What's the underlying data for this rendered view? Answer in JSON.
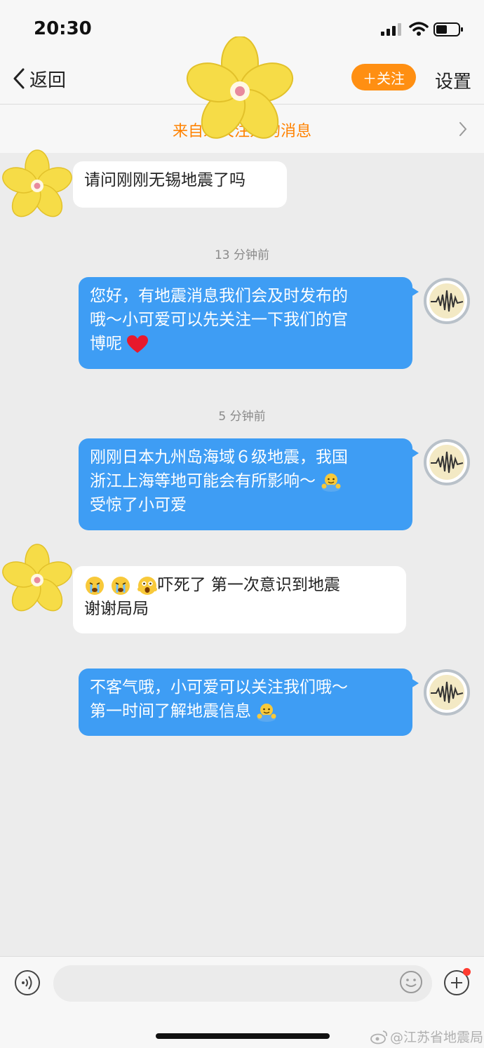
{
  "status_bar": {
    "time": "20:30"
  },
  "nav": {
    "back_label": "返回",
    "follow_label": "＋关注",
    "settings_label": "设置"
  },
  "banner": {
    "text": "来自未关注人的消息"
  },
  "messages": [
    {
      "from": "user",
      "text": "请问刚刚无锡地震了吗"
    },
    {
      "from": "bureau",
      "lines": [
        "您好，有地震消息我们会及时发布的",
        "哦～小可爱可以先关注一下我们的官",
        "博呢"
      ],
      "emoji": "heart"
    },
    {
      "from": "bureau",
      "lines": [
        "刚刚日本九州岛海域６级地震，我国",
        "浙江上海等地可能会有所影响～",
        "受惊了小可爱"
      ],
      "emoji": "hug"
    },
    {
      "from": "user",
      "lines": [
        "吓死了 第一次意识到地震",
        "谢谢局局"
      ],
      "emoji": [
        "crying",
        "crying",
        "scared"
      ]
    },
    {
      "from": "bureau",
      "lines": [
        "不客气哦，小可爱可以关注我们哦～",
        "第一时间了解地震信息"
      ],
      "emoji": "hug"
    }
  ],
  "timestamps": [
    "13 分钟前",
    "5 分钟前"
  ],
  "watermark": "@江苏省地震局",
  "colors": {
    "accent": "#ff8f12",
    "bubble_out": "#3e9df4",
    "banner_text": "#ff8200"
  }
}
